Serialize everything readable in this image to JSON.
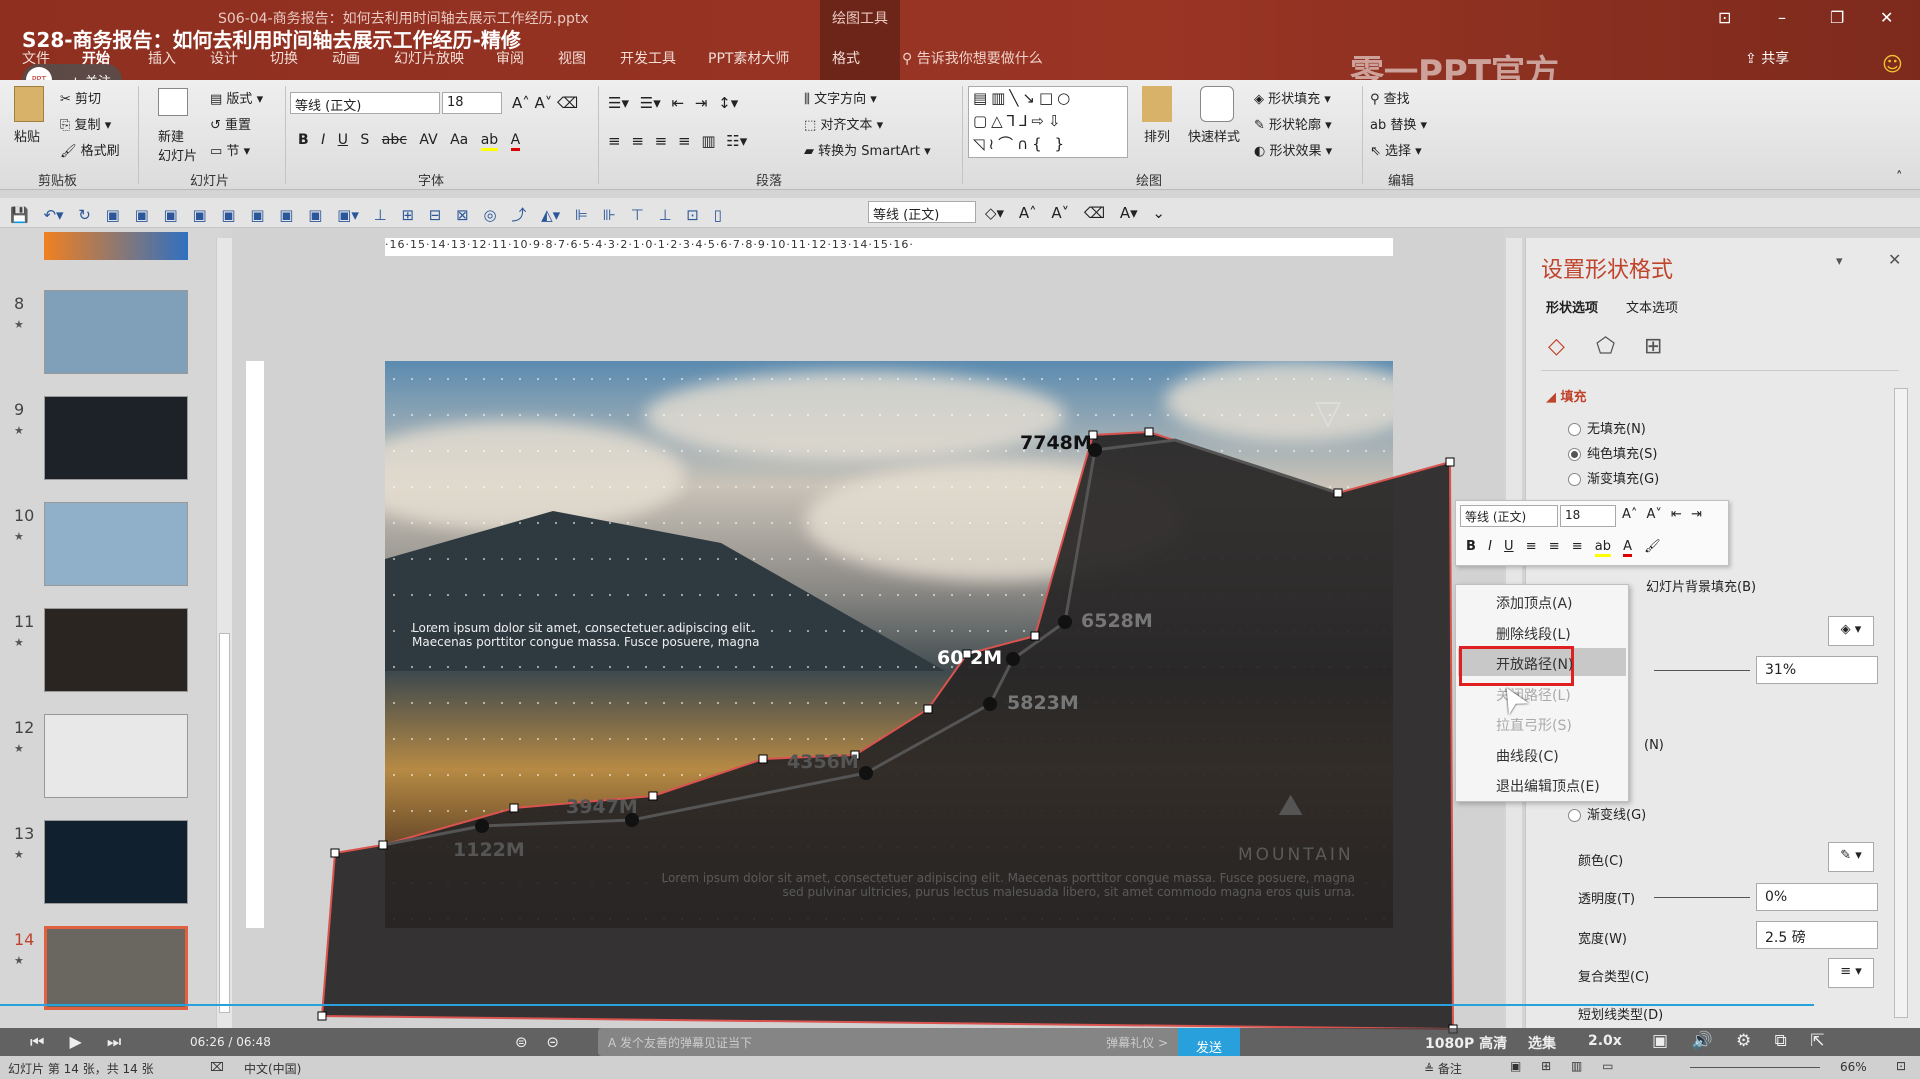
{
  "window": {
    "file_title": "S06-04-商务报告：如何去利用时间轴去展示工作经历.pptx",
    "video_title": "S28-商务报告：如何去利用时间轴去展示工作经历-精修",
    "context_tool": "绘图工具",
    "brand_watermark": "零一PPT官方",
    "follow": "+ 关注",
    "logo_text": "PPT"
  },
  "tabs": [
    "文件",
    "开始",
    "插入",
    "设计",
    "切换",
    "动画",
    "幻灯片放映",
    "审阅",
    "视图",
    "开发工具",
    "PPT素材大师",
    "格式"
  ],
  "tell_me": "告诉我你想要做什么",
  "share": "共享",
  "ribbon": {
    "clipboard": {
      "paste": "粘贴",
      "cut": "剪切",
      "copy": "复制",
      "format_painter": "格式刷",
      "group": "剪贴板"
    },
    "slides": {
      "new": "新建",
      "new2": "幻灯片",
      "layout": "版式",
      "reset": "重置",
      "section": "节",
      "group": "幻灯片"
    },
    "font": {
      "name": "等线 (正文)",
      "size": "18",
      "group": "字体",
      "bold": "B",
      "italic": "I",
      "underline": "U",
      "shadow": "S",
      "strike": "abc",
      "spacing": "AV",
      "case": "Aa"
    },
    "paragraph": {
      "text_direction": "文字方向",
      "align_text": "对齐文本",
      "smartart": "转换为 SmartArt",
      "group": "段落"
    },
    "drawing": {
      "arrange": "排列",
      "quick_styles": "快速样式",
      "fill": "形状填充",
      "outline": "形状轮廓",
      "effects": "形状效果",
      "group": "绘图"
    },
    "editing": {
      "find": "查找",
      "replace": "替换",
      "select": "选择",
      "group": "编辑"
    }
  },
  "qat": {
    "font": "等线 (正文)"
  },
  "ruler": "·16·15·14·13·12·11·10·9·8·7·6·5·4·3·2·1·0·1·2·3·4·5·6·7·8·9·10·11·12·13·14·15·16·",
  "slides": [
    {
      "n": "8",
      "c": "#7fa0b8"
    },
    {
      "n": "9",
      "c": "#1c2228"
    },
    {
      "n": "10",
      "c": "#8fb0c8"
    },
    {
      "n": "11",
      "c": "#2a2520"
    },
    {
      "n": "12",
      "c": "#e8e8e8"
    },
    {
      "n": "13",
      "c": "#10202e"
    },
    {
      "n": "14",
      "c": "#6a6660"
    }
  ],
  "slide": {
    "text_left": "Lorem ipsum dolor sit amet, consectetuer adipiscing elit. Maecenas porttitor congue massa. Fusce posuere, magna",
    "text_bottom1": "Lorem ipsum dolor sit amet, consectetuer adipiscing elit. Maecenas porttitor congue massa. Fusce posuere, magna",
    "text_bottom2": "sed pulvinar ultricies, purus lectus malesuada libero, sit amet commodo magna eros quis urna.",
    "mountain": "MOUNTAIN",
    "labels": [
      "7748M",
      "6528M",
      "60 2M",
      "5823M",
      "4356M",
      "3947M",
      "1122M"
    ]
  },
  "pane": {
    "title": "设置形状格式",
    "tab_shape": "形状选项",
    "tab_text": "文本选项",
    "fill_section": "填充",
    "no_fill": "无填充(N)",
    "solid_fill": "纯色填充(S)",
    "gradient_fill": "渐变填充(G)",
    "bg_fill": "幻灯片背景填充(B)",
    "fill_transparency": "31%",
    "line_gradient": "渐变线(G)",
    "color": "颜色(C)",
    "transparency": "透明度(T)",
    "transparency_value": "0%",
    "width": "宽度(W)",
    "width_value": "2.5 磅",
    "compound": "复合类型(C)",
    "dash": "短划线类型(D)",
    "line_none": "(N)"
  },
  "context_menu": [
    {
      "label": "添加顶点(A)",
      "disabled": false
    },
    {
      "label": "删除线段(L)",
      "disabled": false
    },
    {
      "label": "开放路径(N)",
      "disabled": false,
      "highlight": true
    },
    {
      "label": "关闭路径(L)",
      "disabled": true
    },
    {
      "label": "拉直弓形(S)",
      "disabled": true
    },
    {
      "label": "曲线段(C)",
      "disabled": false
    },
    {
      "label": "退出编辑顶点(E)",
      "disabled": false
    }
  ],
  "mini_toolbar": {
    "font": "等线 (正文)",
    "size": "18"
  },
  "video": {
    "time": "06:26 / 06:48",
    "danmaku_placeholder": "发个友善的弹幕见证当下",
    "etiquette": "弹幕礼仪 >",
    "send": "发送",
    "quality": "1080P 高清",
    "episodes": "选集",
    "speed": "2.0x",
    "progress_percent": 94.5
  },
  "status": {
    "slide": "幻灯片 第 14 张，共 14 张",
    "lang": "中文(中国)",
    "notes": "备注",
    "zoom": "66%"
  },
  "colors": {
    "accent": "#c0432b",
    "title_bar": "#9a3524",
    "send": "#27a0dc"
  }
}
